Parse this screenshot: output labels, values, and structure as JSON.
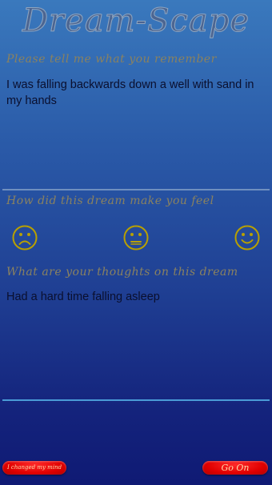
{
  "app": {
    "title": "Dream-Scape"
  },
  "section1": {
    "heading": "Please tell me what you remember",
    "text": "I was falling backwards down a well with sand in my hands"
  },
  "section2": {
    "heading": "How did this dream make you feel",
    "moods": [
      {
        "name": "sad",
        "icon": "sad-face-icon"
      },
      {
        "name": "neutral",
        "icon": "neutral-face-icon"
      },
      {
        "name": "happy",
        "icon": "happy-face-icon"
      }
    ]
  },
  "section3": {
    "heading": "What are your thoughts on this dream",
    "text": "Had a hard time falling asleep"
  },
  "buttons": {
    "changed_mind_label": "I changed my mind",
    "go_on_label": "Go On"
  },
  "colors": {
    "heading": "#8a8260",
    "face_stroke": "#b8a000",
    "button": "#e00000"
  }
}
